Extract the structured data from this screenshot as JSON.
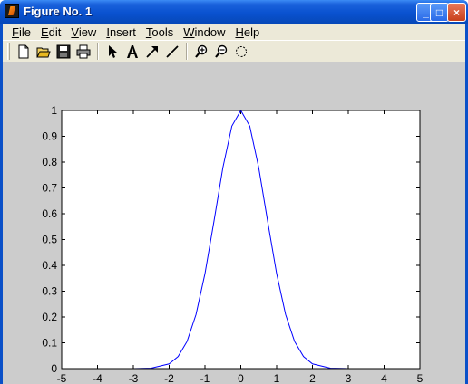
{
  "window": {
    "title": "Figure No. 1",
    "controls": {
      "minimize": "_",
      "maximize": "□",
      "close": "×"
    }
  },
  "menubar": {
    "items": [
      {
        "label": "File",
        "u": "F",
        "rest": "ile"
      },
      {
        "label": "Edit",
        "u": "E",
        "rest": "dit"
      },
      {
        "label": "View",
        "u": "V",
        "rest": "iew"
      },
      {
        "label": "Insert",
        "u": "I",
        "rest": "nsert"
      },
      {
        "label": "Tools",
        "u": "T",
        "rest": "ools"
      },
      {
        "label": "Window",
        "u": "W",
        "rest": "indow"
      },
      {
        "label": "Help",
        "u": "H",
        "rest": "elp"
      }
    ]
  },
  "toolbar": {
    "tools": [
      "new-figure-icon",
      "open-file-icon",
      "save-icon",
      "print-icon",
      "select-arrow-icon",
      "insert-text-icon",
      "insert-arrow-icon",
      "insert-line-icon",
      "zoom-in-icon",
      "zoom-out-icon",
      "rotate-3d-icon"
    ]
  },
  "colors": {
    "line": "#0000ff",
    "axes_bg": "#ffffff",
    "figure_bg": "#cccccc",
    "titlebar": "#0a52d0"
  },
  "chart_data": {
    "type": "line",
    "title": "",
    "xlabel": "",
    "ylabel": "",
    "xlim": [
      -5,
      5
    ],
    "ylim": [
      0,
      1
    ],
    "xticks": [
      -5,
      -4,
      -3,
      -2,
      -1,
      0,
      1,
      2,
      3,
      4,
      5
    ],
    "yticks": [
      0,
      0.1,
      0.2,
      0.3,
      0.4,
      0.5,
      0.6,
      0.7,
      0.8,
      0.9,
      1
    ],
    "xticklabels": [
      "-5",
      "-4",
      "-3",
      "-2",
      "-1",
      "0",
      "1",
      "2",
      "3",
      "4",
      "5"
    ],
    "yticklabels": [
      "0",
      "0.1",
      "0.2",
      "0.3",
      "0.4",
      "0.5",
      "0.6",
      "0.7",
      "0.8",
      "0.9",
      "1"
    ],
    "grid": false,
    "series": [
      {
        "color": "#0000ff",
        "x": [
          -5,
          -4.5,
          -4,
          -3.5,
          -3,
          -2.5,
          -2,
          -1.75,
          -1.5,
          -1.25,
          -1,
          -0.75,
          -0.5,
          -0.25,
          0,
          0.25,
          0.5,
          0.75,
          1,
          1.25,
          1.5,
          1.75,
          2,
          2.5,
          3,
          3.5,
          4,
          4.5,
          5
        ],
        "y": [
          0,
          0,
          0,
          0,
          0.0001,
          0.0019,
          0.0183,
          0.0468,
          0.1054,
          0.2096,
          0.3679,
          0.5698,
          0.7788,
          0.9394,
          1,
          0.9394,
          0.7788,
          0.5698,
          0.3679,
          0.2096,
          0.1054,
          0.0468,
          0.0183,
          0.0019,
          0.0001,
          0,
          0,
          0,
          0
        ]
      }
    ]
  }
}
